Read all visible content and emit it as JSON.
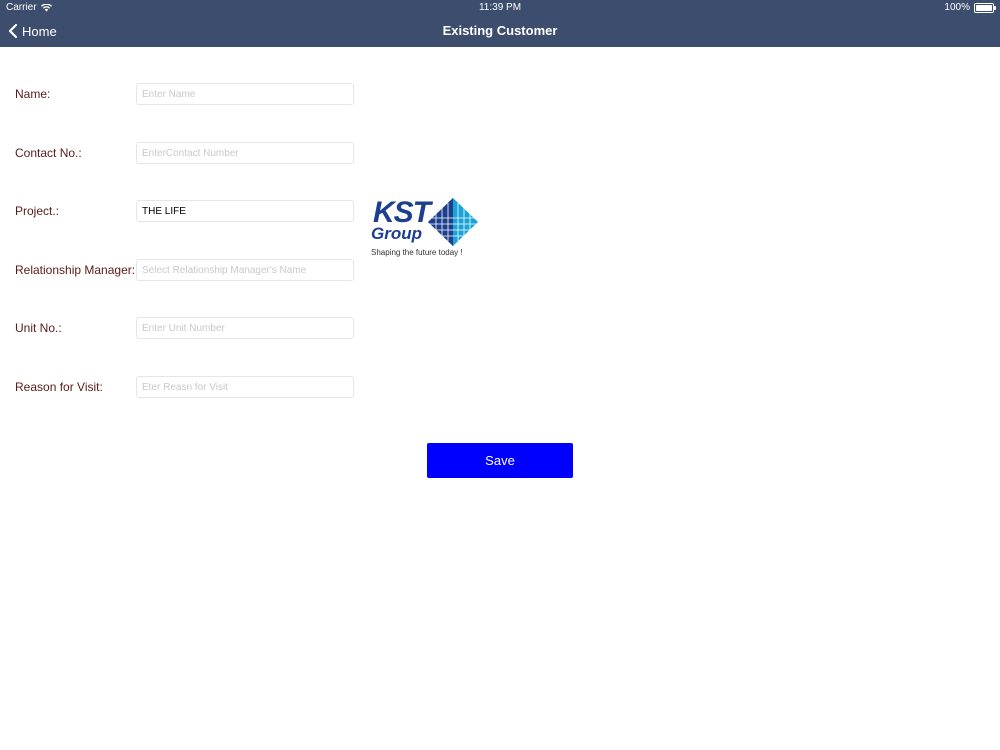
{
  "status_bar": {
    "carrier": "Carrier",
    "time": "11:39 PM",
    "battery": "100%"
  },
  "nav": {
    "back_label": "Home",
    "title": "Existing Customer"
  },
  "form": {
    "name": {
      "label": "Name:",
      "placeholder": "Enter Name",
      "value": ""
    },
    "contact": {
      "label": "Contact No.:",
      "placeholder": "EnterContact Number",
      "value": ""
    },
    "project": {
      "label": "Project.:",
      "placeholder": "",
      "value": "THE LIFE"
    },
    "manager": {
      "label": "Relationship Manager:",
      "placeholder": "Select Relationship Manager's Name",
      "value": ""
    },
    "unit": {
      "label": "Unit No.:",
      "placeholder": "Enter Unit Number",
      "value": ""
    },
    "reason": {
      "label": "Reason for Visit:",
      "placeholder": "Eter Reasn for Visit",
      "value": ""
    }
  },
  "logo": {
    "brand": "KST",
    "sub": "Group",
    "tagline": "Shaping the future today !"
  },
  "actions": {
    "save_label": "Save"
  },
  "colors": {
    "nav_bg": "#3d4d6d",
    "label_text": "#5a1a1a",
    "save_bg": "#0000ff",
    "logo_blue": "#1d3f8e",
    "logo_cyan": "#1aa3d9"
  }
}
